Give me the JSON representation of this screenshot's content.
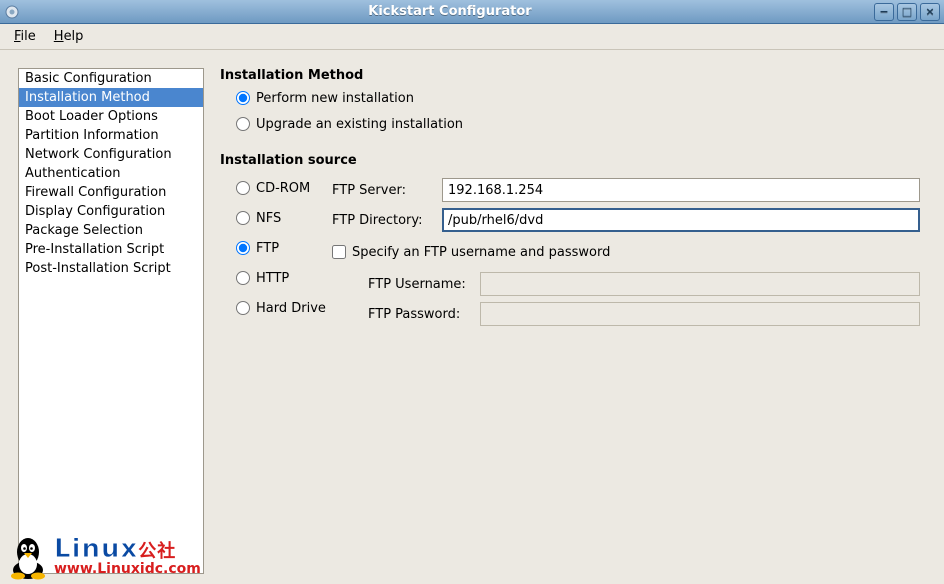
{
  "window": {
    "title": "Kickstart Configurator",
    "controls": {
      "minimize": "−",
      "maximize": "□",
      "close": "×"
    }
  },
  "menubar": {
    "file": "File",
    "help": "Help"
  },
  "sidebar": {
    "items": [
      "Basic Configuration",
      "Installation Method",
      "Boot Loader Options",
      "Partition Information",
      "Network Configuration",
      "Authentication",
      "Firewall Configuration",
      "Display Configuration",
      "Package Selection",
      "Pre-Installation Script",
      "Post-Installation Script"
    ],
    "selected_index": 1
  },
  "main": {
    "installation_method": {
      "title": "Installation Method",
      "options": {
        "new": "Perform new installation",
        "upgrade": "Upgrade an existing installation"
      },
      "selected": "new"
    },
    "installation_source": {
      "title": "Installation source",
      "options": {
        "cdrom": "CD-ROM",
        "nfs": "NFS",
        "ftp": "FTP",
        "http": "HTTP",
        "hard_drive": "Hard Drive"
      },
      "selected": "ftp",
      "ftp": {
        "server_label": "FTP Server:",
        "server_value": "192.168.1.254",
        "directory_label": "FTP Directory:",
        "directory_value": "/pub/rhel6/dvd",
        "auth_checkbox_label": "Specify an FTP username and password",
        "auth_checked": false,
        "username_label": "FTP Username:",
        "username_value": "",
        "password_label": "FTP Password:",
        "password_value": ""
      }
    }
  },
  "watermark": {
    "line1_main": "Linux",
    "line1_cn": "公社",
    "line2": "www.Linuxidc.com"
  }
}
